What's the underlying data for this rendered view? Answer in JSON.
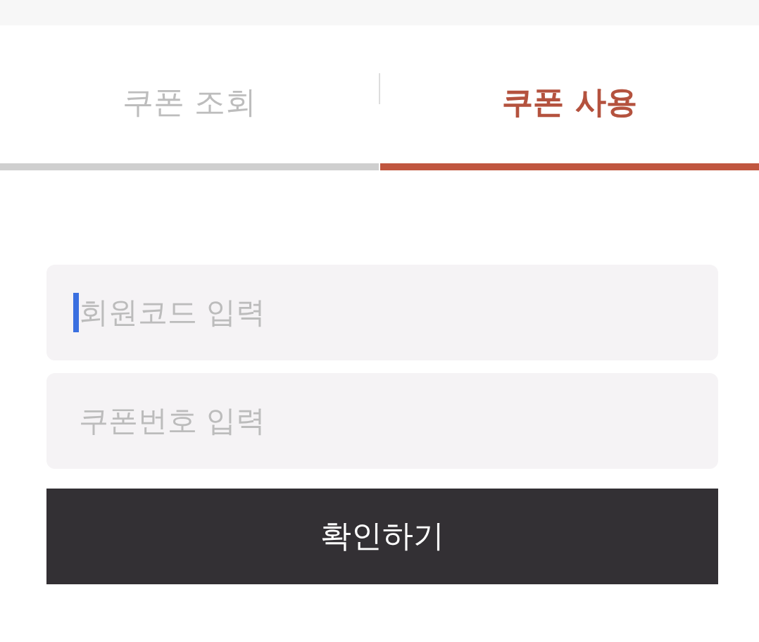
{
  "tabs": [
    {
      "label": "쿠폰 조회",
      "selected": false
    },
    {
      "label": "쿠폰 사용",
      "selected": true
    }
  ],
  "fields": [
    {
      "placeholder": "회원코드 입력",
      "focused": true
    },
    {
      "placeholder": "쿠폰번호 입력",
      "focused": false
    }
  ],
  "submit_button": {
    "label": "확인하기"
  }
}
